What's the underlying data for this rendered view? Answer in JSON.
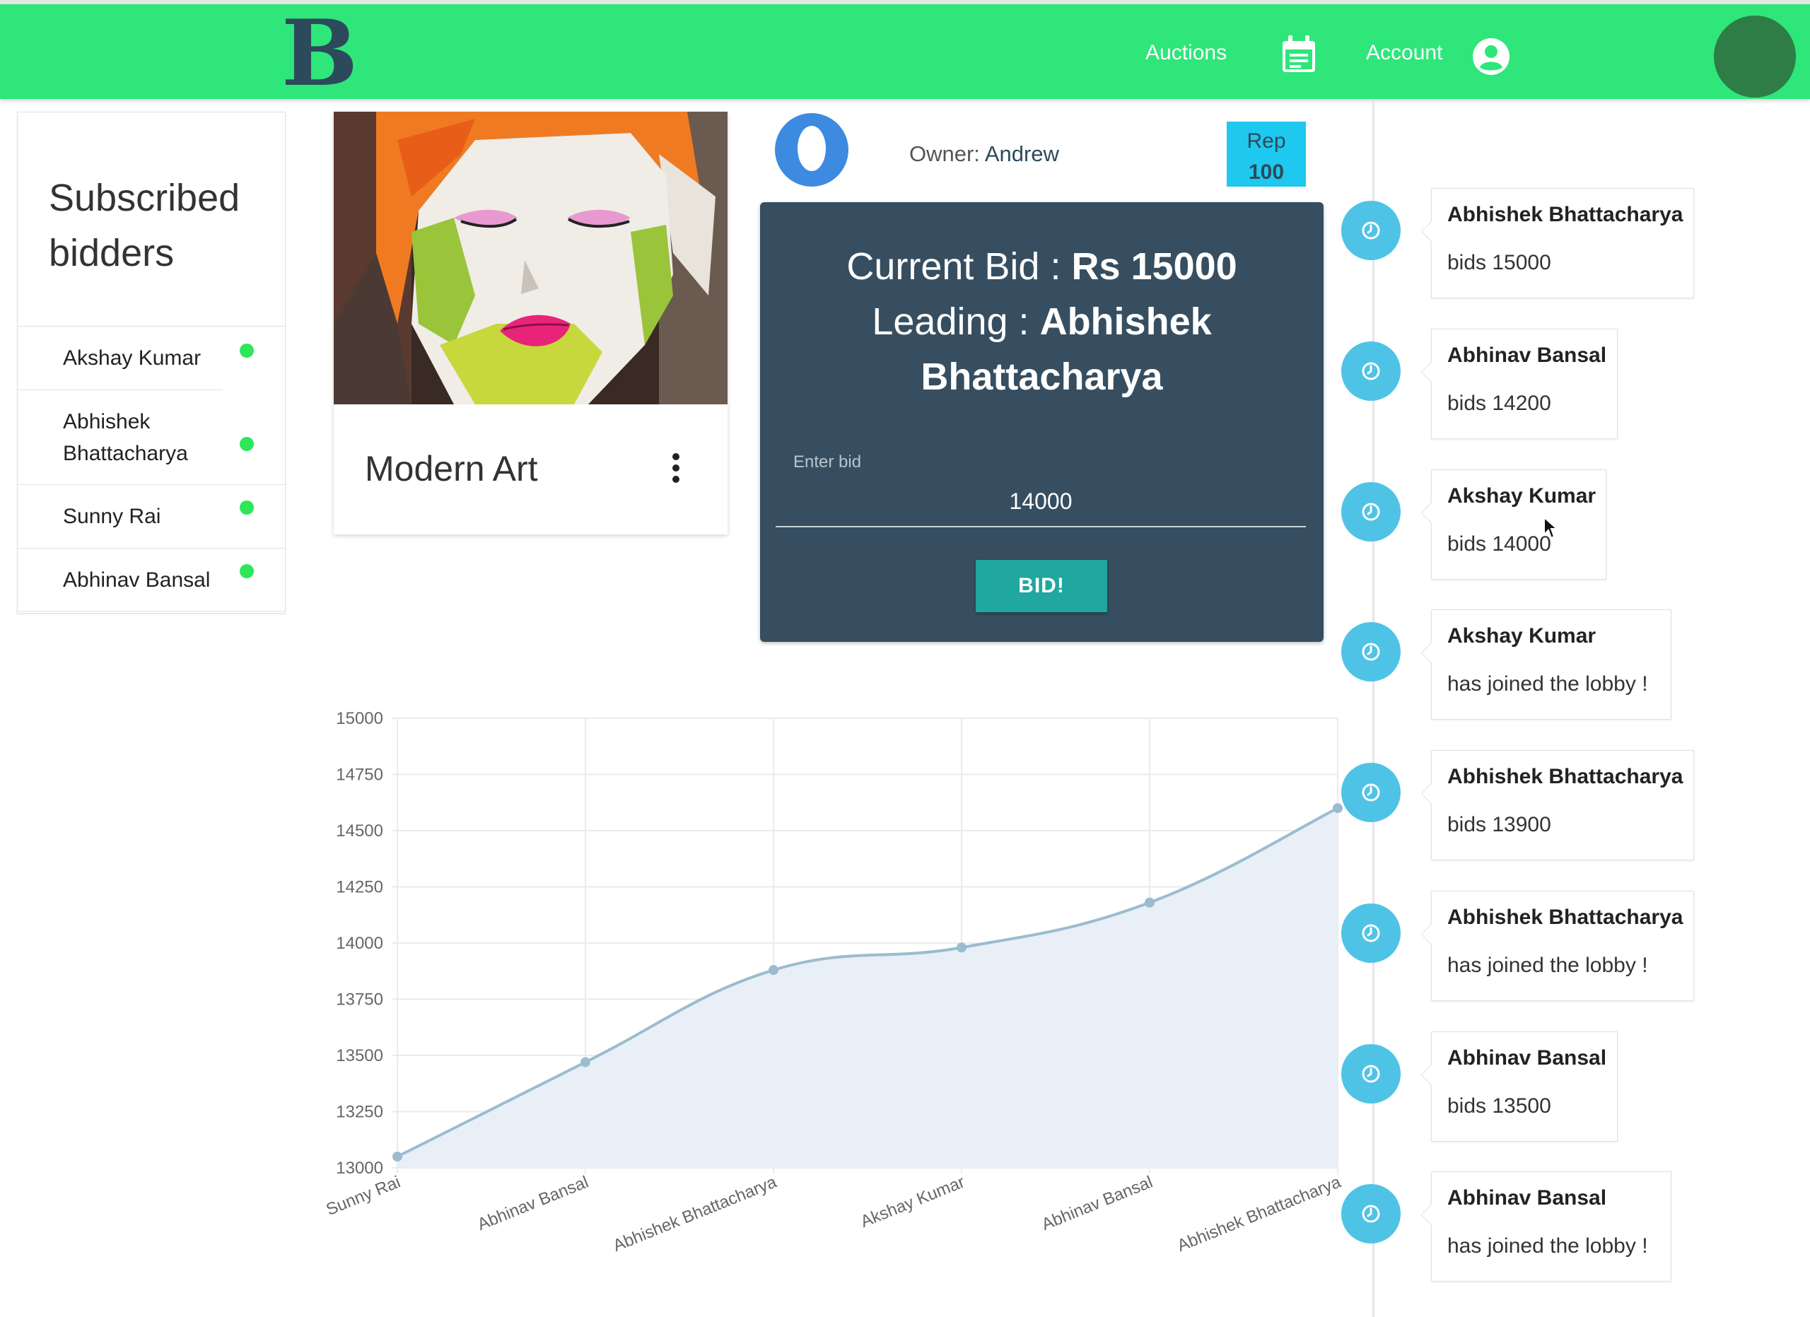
{
  "header": {
    "logo": "B",
    "nav": {
      "auctions": "Auctions",
      "account": "Account"
    },
    "colors": {
      "bar": "#2ee67a",
      "logo": "#2d4a5c"
    }
  },
  "sidebar": {
    "title": "Subscribed bidders",
    "bidders": [
      {
        "name": "Akshay Kumar",
        "online": true
      },
      {
        "name": "Abhishek Bhattacharya",
        "online": true
      },
      {
        "name": "Sunny Rai",
        "online": true
      },
      {
        "name": "Abhinav Bansal",
        "online": true
      }
    ]
  },
  "item": {
    "title": "Modern Art",
    "owner_label": "Owner:",
    "owner_name": "Andrew",
    "rep_label": "Rep",
    "rep_value": "100"
  },
  "bid": {
    "current_label": "Current Bid :",
    "current_value": "Rs 15000",
    "leading_label": "Leading :",
    "leading_first": "Abhishek",
    "leading_last": "Bhattacharya",
    "input_label": "Enter bid",
    "input_value": "14000",
    "button": "BID!"
  },
  "timeline": [
    {
      "name": "Abhishek Bhattacharya",
      "message": "bids 15000"
    },
    {
      "name": "Abhinav Bansal",
      "message": "bids 14200"
    },
    {
      "name": "Akshay Kumar",
      "message": "bids 14000"
    },
    {
      "name": "Akshay Kumar",
      "message": "has joined the lobby !"
    },
    {
      "name": "Abhishek Bhattacharya",
      "message": "bids 13900"
    },
    {
      "name": "Abhishek Bhattacharya",
      "message": "has joined the lobby !"
    },
    {
      "name": "Abhinav Bansal",
      "message": "bids 13500"
    },
    {
      "name": "Abhinav Bansal",
      "message": "has joined the lobby !"
    }
  ],
  "chart_data": {
    "type": "area",
    "categories": [
      "Sunny Rai",
      "Abhinav Bansal",
      "Abhishek Bhattacharya",
      "Akshay Kumar",
      "Abhinav Bansal",
      "Abhishek Bhattacharya"
    ],
    "values": [
      13050,
      13470,
      13880,
      13980,
      14180,
      14600
    ],
    "yticks": [
      15000,
      14750,
      14500,
      14250,
      14000,
      13750,
      13500,
      13250,
      13000
    ],
    "ylim": [
      13000,
      15000
    ],
    "grid": true,
    "colors": {
      "line": "#9bbccf",
      "fill": "#e9eff7",
      "point": "#9bbccf"
    }
  }
}
